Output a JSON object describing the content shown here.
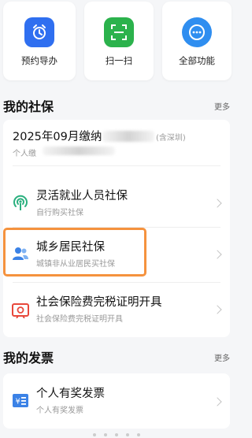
{
  "shortcuts": [
    {
      "label": "预约导办",
      "icon": "clock-icon"
    },
    {
      "label": "扫一扫",
      "icon": "scan-icon"
    },
    {
      "label": "全部功能",
      "icon": "more-dots-icon"
    }
  ],
  "social_security": {
    "title": "我的社保",
    "more": "更多",
    "payment": {
      "title_prefix": "2025年09月缴纳",
      "title_suffix": "含深圳",
      "sub_prefix": "个人缴"
    },
    "items": [
      {
        "title": "灵活就业人员社保",
        "sub": "自行购买社保",
        "icon": "broadcast-icon"
      },
      {
        "title": "城乡居民社保",
        "sub": "城镇非从业居民买社保",
        "icon": "people-icon"
      },
      {
        "title": "社会保险费完税证明开具",
        "sub": "社会保险费完税证明开具",
        "icon": "certificate-icon"
      }
    ]
  },
  "invoices": {
    "title": "我的发票",
    "more": "更多",
    "items": [
      {
        "title": "个人有奖发票",
        "sub": "个人有奖发票",
        "icon": "invoice-icon"
      }
    ]
  },
  "colors": {
    "highlight": "#f5923e",
    "blue": "#2f6ff0",
    "green": "#2bb24c",
    "teal": "#2bb07f",
    "red": "#e8483b"
  }
}
